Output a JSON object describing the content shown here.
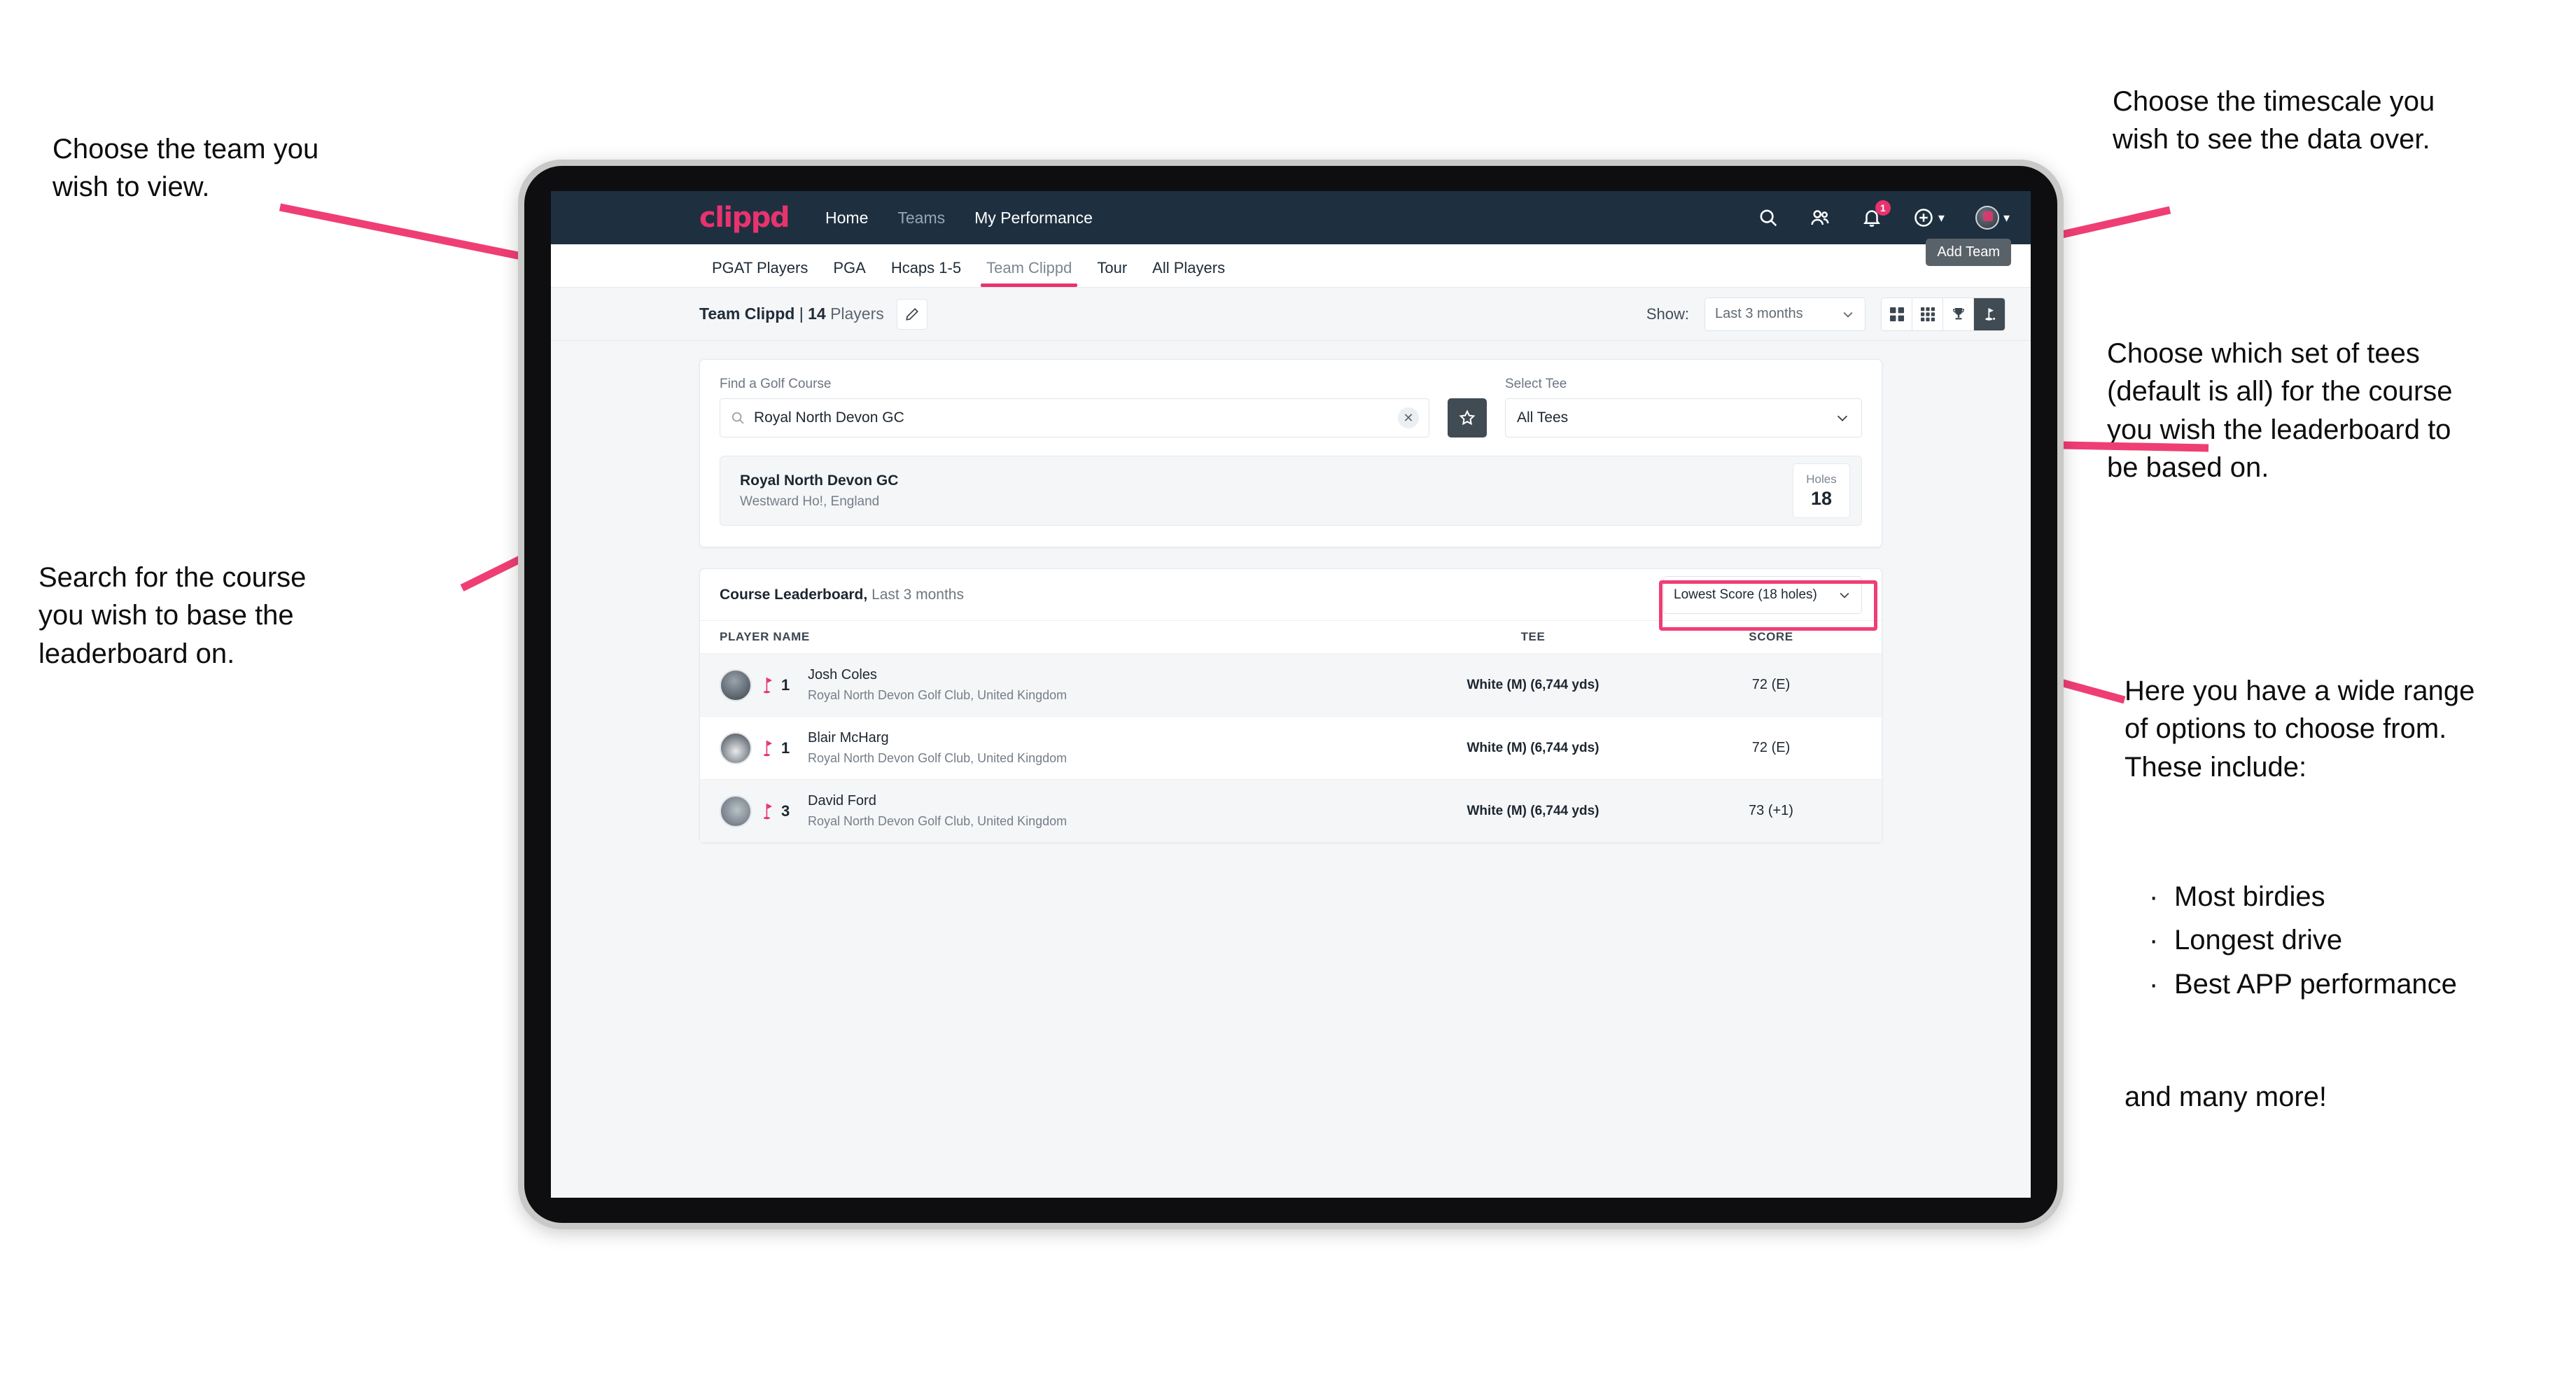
{
  "annotations": {
    "team": "Choose the team you\nwish to view.",
    "timescale": "Choose the timescale you\nwish to see the data over.",
    "tees": "Choose which set of tees\n(default is all) for the course\nyou wish the leaderboard to\nbe based on.",
    "search": "Search for the course\nyou wish to base the\nleaderboard on.",
    "options_intro": "Here you have a wide range\nof options to choose from.\nThese include:",
    "options_list": [
      "Most birdies",
      "Longest drive",
      "Best APP performance"
    ],
    "options_outro": "and many more!"
  },
  "appbar": {
    "logo": "clippd",
    "nav": [
      {
        "label": "Home",
        "dim": false
      },
      {
        "label": "Teams",
        "dim": true
      },
      {
        "label": "My Performance",
        "dim": false
      }
    ],
    "icons": {
      "search": "search-icon",
      "people": "people-icon",
      "bell": "bell-icon",
      "bell_badge": "1",
      "plus": "plus-circle-icon",
      "avatar": "user-avatar"
    }
  },
  "tabs": [
    {
      "label": "PGAT Players",
      "active": false,
      "muted": false
    },
    {
      "label": "PGA",
      "active": false,
      "muted": false
    },
    {
      "label": "Hcaps 1-5",
      "active": false,
      "muted": false
    },
    {
      "label": "Team Clippd",
      "active": true,
      "muted": true
    },
    {
      "label": "Tour",
      "active": false,
      "muted": false
    },
    {
      "label": "All Players",
      "active": false,
      "muted": false
    }
  ],
  "tooltip": {
    "add_team": "Add Team"
  },
  "toolbar": {
    "team_name": "Team Clippd",
    "separator": "|",
    "player_count": "14",
    "players_word": "Players",
    "edit_icon": "pencil-icon",
    "show_label": "Show:",
    "show_value": "Last 3 months",
    "view_buttons": [
      {
        "name": "grid-4-view",
        "active": false
      },
      {
        "name": "grid-9-view",
        "active": false
      },
      {
        "name": "trophy-view",
        "active": false
      },
      {
        "name": "golf-flag-view",
        "active": true
      }
    ]
  },
  "search_panel": {
    "course_label": "Find a Golf Course",
    "course_value": "Royal North Devon GC",
    "course_placeholder": "Find a Golf Course",
    "clear_icon": "close-icon",
    "favourite_icon": "star-icon",
    "tee_label": "Select Tee",
    "tee_value": "All Tees"
  },
  "course_result": {
    "name": "Royal North Devon GC",
    "location": "Westward Ho!, England",
    "holes_label": "Holes",
    "holes_value": "18"
  },
  "leaderboard": {
    "title": "Course Leaderboard,",
    "subtitle": "Last 3 months",
    "metric_value": "Lowest Score (18 holes)",
    "columns": {
      "name": "PLAYER NAME",
      "tee": "TEE",
      "score": "SCORE"
    },
    "rows": [
      {
        "rank": "1",
        "name": "Josh Coles",
        "club": "Royal North Devon Golf Club, United Kingdom",
        "tee": "White (M) (6,744 yds)",
        "score": "72 (E)"
      },
      {
        "rank": "1",
        "name": "Blair McHarg",
        "club": "Royal North Devon Golf Club, United Kingdom",
        "tee": "White (M) (6,744 yds)",
        "score": "72 (E)"
      },
      {
        "rank": "3",
        "name": "David Ford",
        "club": "Royal North Devon Golf Club, United Kingdom",
        "tee": "White (M) (6,744 yds)",
        "score": "73 (+1)"
      }
    ]
  },
  "colors": {
    "accent_pink": "#e8336e",
    "annotation_arrow": "#ef3e74",
    "appbar_bg": "#1e3040",
    "dark_button": "#414b54"
  }
}
